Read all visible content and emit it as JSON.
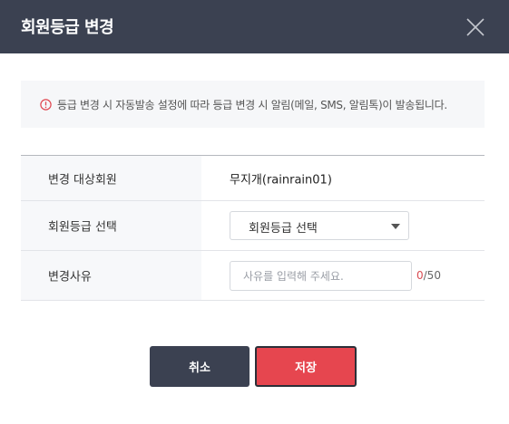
{
  "modal": {
    "title": "회원등급 변경"
  },
  "notice": {
    "text": "등급 변경 시 자동발송 설정에 따라 등급 변경 시 알림(메일, SMS, 알림톡)이 발송됩니다."
  },
  "form": {
    "target_label": "변경 대상회원",
    "target_value": "무지개(rainrain01)",
    "grade_label": "회원등급 선택",
    "grade_selected": "회원등급 선택",
    "reason_label": "변경사유",
    "reason_value": "",
    "reason_placeholder": "사유를 입력해 주세요.",
    "reason_count": "0",
    "reason_max": "/50"
  },
  "buttons": {
    "cancel_label": "취소",
    "save_label": "저장"
  },
  "colors": {
    "header_bg": "#3b4151",
    "accent_red": "#e6464f",
    "counter_red": "#d94b52"
  },
  "icons": {
    "close": "close-icon",
    "info": "info-circle-icon",
    "dropdown": "caret-down-icon"
  }
}
